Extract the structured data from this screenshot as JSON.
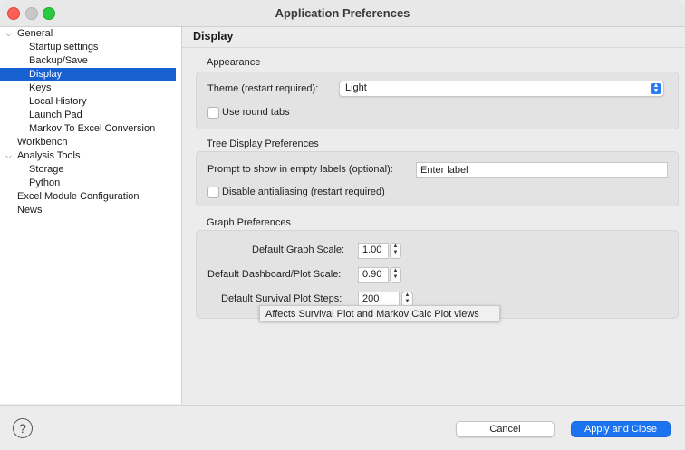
{
  "window": {
    "title": "Application Preferences"
  },
  "sidebar": {
    "items": [
      {
        "label": "General",
        "expanded": true
      },
      {
        "label": "Startup settings"
      },
      {
        "label": "Backup/Save"
      },
      {
        "label": "Display",
        "selected": true
      },
      {
        "label": "Keys"
      },
      {
        "label": "Local History"
      },
      {
        "label": "Launch Pad"
      },
      {
        "label": "Markov To Excel Conversion"
      },
      {
        "label": "Workbench"
      },
      {
        "label": "Analysis Tools",
        "expanded": true
      },
      {
        "label": "Storage"
      },
      {
        "label": "Python"
      },
      {
        "label": "Excel Module Configuration"
      },
      {
        "label": "News"
      }
    ]
  },
  "page": {
    "title": "Display"
  },
  "appearance": {
    "group_label": "Appearance",
    "theme_label": "Theme (restart required):",
    "theme_value": "Light",
    "round_tabs_label": "Use round tabs"
  },
  "tree_display": {
    "group_label": "Tree Display Preferences",
    "prompt_label": "Prompt to show in empty labels (optional):",
    "prompt_value": "Enter label",
    "antialias_label": "Disable antialiasing (restart required)"
  },
  "graph": {
    "group_label": "Graph Preferences",
    "scale_label": "Default Graph Scale:",
    "scale_value": "1.00",
    "dashboard_label": "Default Dashboard/Plot Scale:",
    "dashboard_value": "0.90",
    "survival_label": "Default Survival Plot Steps:",
    "survival_value": "200",
    "tooltip": "Affects Survival Plot and Markov Calc Plot views"
  },
  "footer": {
    "help_glyph": "?",
    "cancel_label": "Cancel",
    "apply_label": "Apply and Close"
  },
  "colors": {
    "selection": "#1660d1",
    "primary_button": "#1b73f0"
  }
}
